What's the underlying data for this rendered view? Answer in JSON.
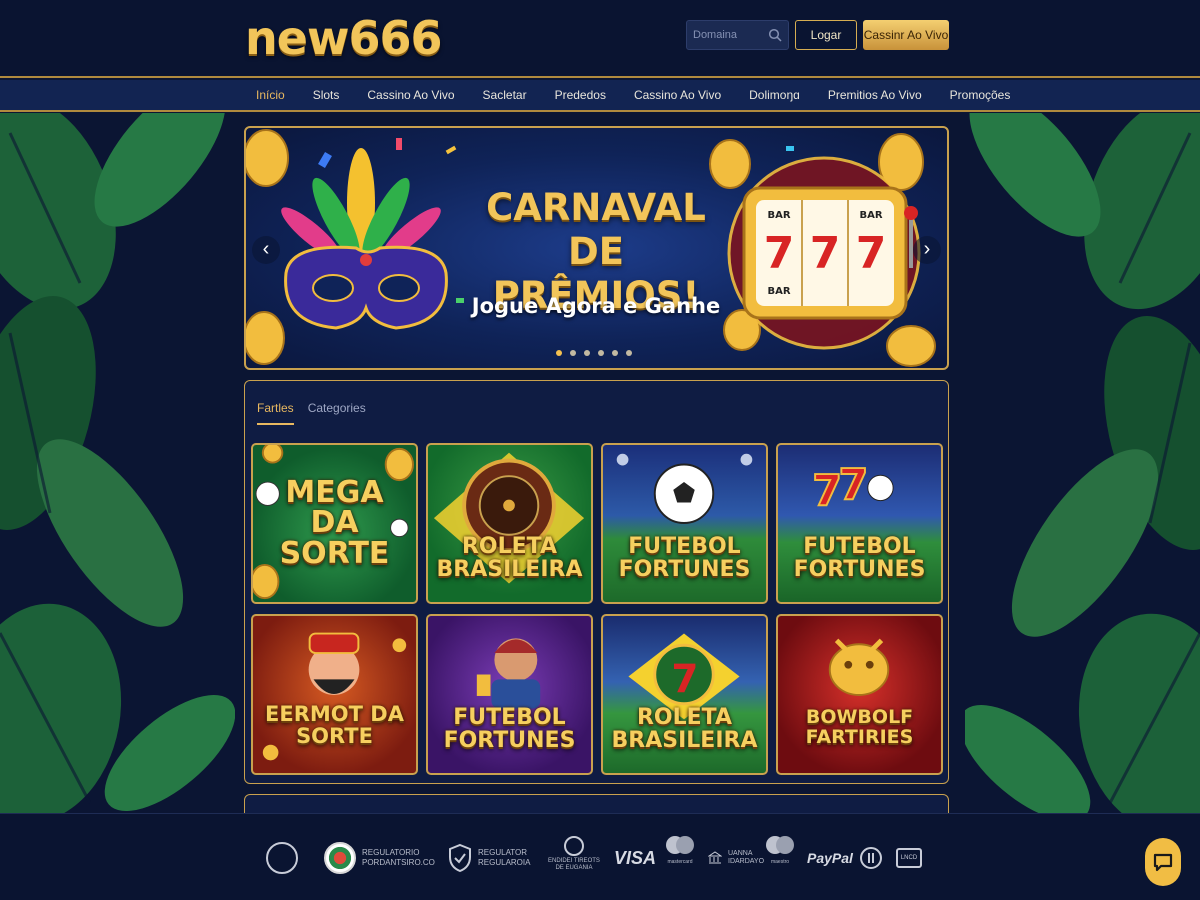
{
  "brand": {
    "logo": "new666"
  },
  "header": {
    "search_placeholder": "Domaina",
    "login_label": "Logar",
    "live_casino_label": "Cassinr Ao Vivo"
  },
  "nav": {
    "items": [
      {
        "label": "Início",
        "active": true
      },
      {
        "label": "Slots"
      },
      {
        "label": "Cassino Ao Vivo"
      },
      {
        "label": "Sacletar"
      },
      {
        "label": "Prededos"
      },
      {
        "label": "Cassino Ao Vivo"
      },
      {
        "label": "Dolimoŋɑ"
      },
      {
        "label": "Premitios Ao Vivo"
      },
      {
        "label": "Promoções"
      }
    ]
  },
  "banner": {
    "title": "CARNAVAL DE PRÊMIOS!",
    "subtitle": "Jogue Agora e Ganhe",
    "slot_symbol": "7",
    "slot_bar": "BAR",
    "slide_count": 6,
    "active_slide": 1
  },
  "games": {
    "tabs": [
      {
        "label": "Fartles",
        "active": true
      },
      {
        "label": "Categories"
      }
    ],
    "items": [
      {
        "title": "MEGA\nDA\nSORTE",
        "theme": "g1"
      },
      {
        "title": "ROLETA\nBRASILEIRA",
        "theme": "g2"
      },
      {
        "title": "FUTEBOL\nFORTUNES",
        "theme": "g3"
      },
      {
        "title": "FUTEBOL\nFORTUNES",
        "theme": "g4"
      },
      {
        "title": "EERMOT DA\nSORTE",
        "theme": "g5"
      },
      {
        "title": "FUTEBOL\nFORTUNES",
        "theme": "g6"
      },
      {
        "title": "ROLETA\nBRASILEIRA",
        "theme": "g7"
      },
      {
        "title": "BOWBOLF\nFARTIRIES",
        "theme": "g8"
      }
    ]
  },
  "footer": {
    "regulator1": "REGULATORIO\nPORDANTSIRO.CO",
    "regulator2": "REGULATOR\nREGULAROIA",
    "regulator3": "ENDIDEI TIREOTS\nDE EUGANIA",
    "visa": "VISA",
    "mastercard_caption": "mastercard",
    "bank_transfer": "UANNA\nIDARDAYO",
    "maestro_caption": "maestro",
    "paypal": "PayPal",
    "wallet_caption": "LNCD"
  },
  "colors": {
    "background": "#0b1533",
    "gold": "#c9a14e",
    "accent": "#e8b860",
    "nav": "#122452"
  }
}
